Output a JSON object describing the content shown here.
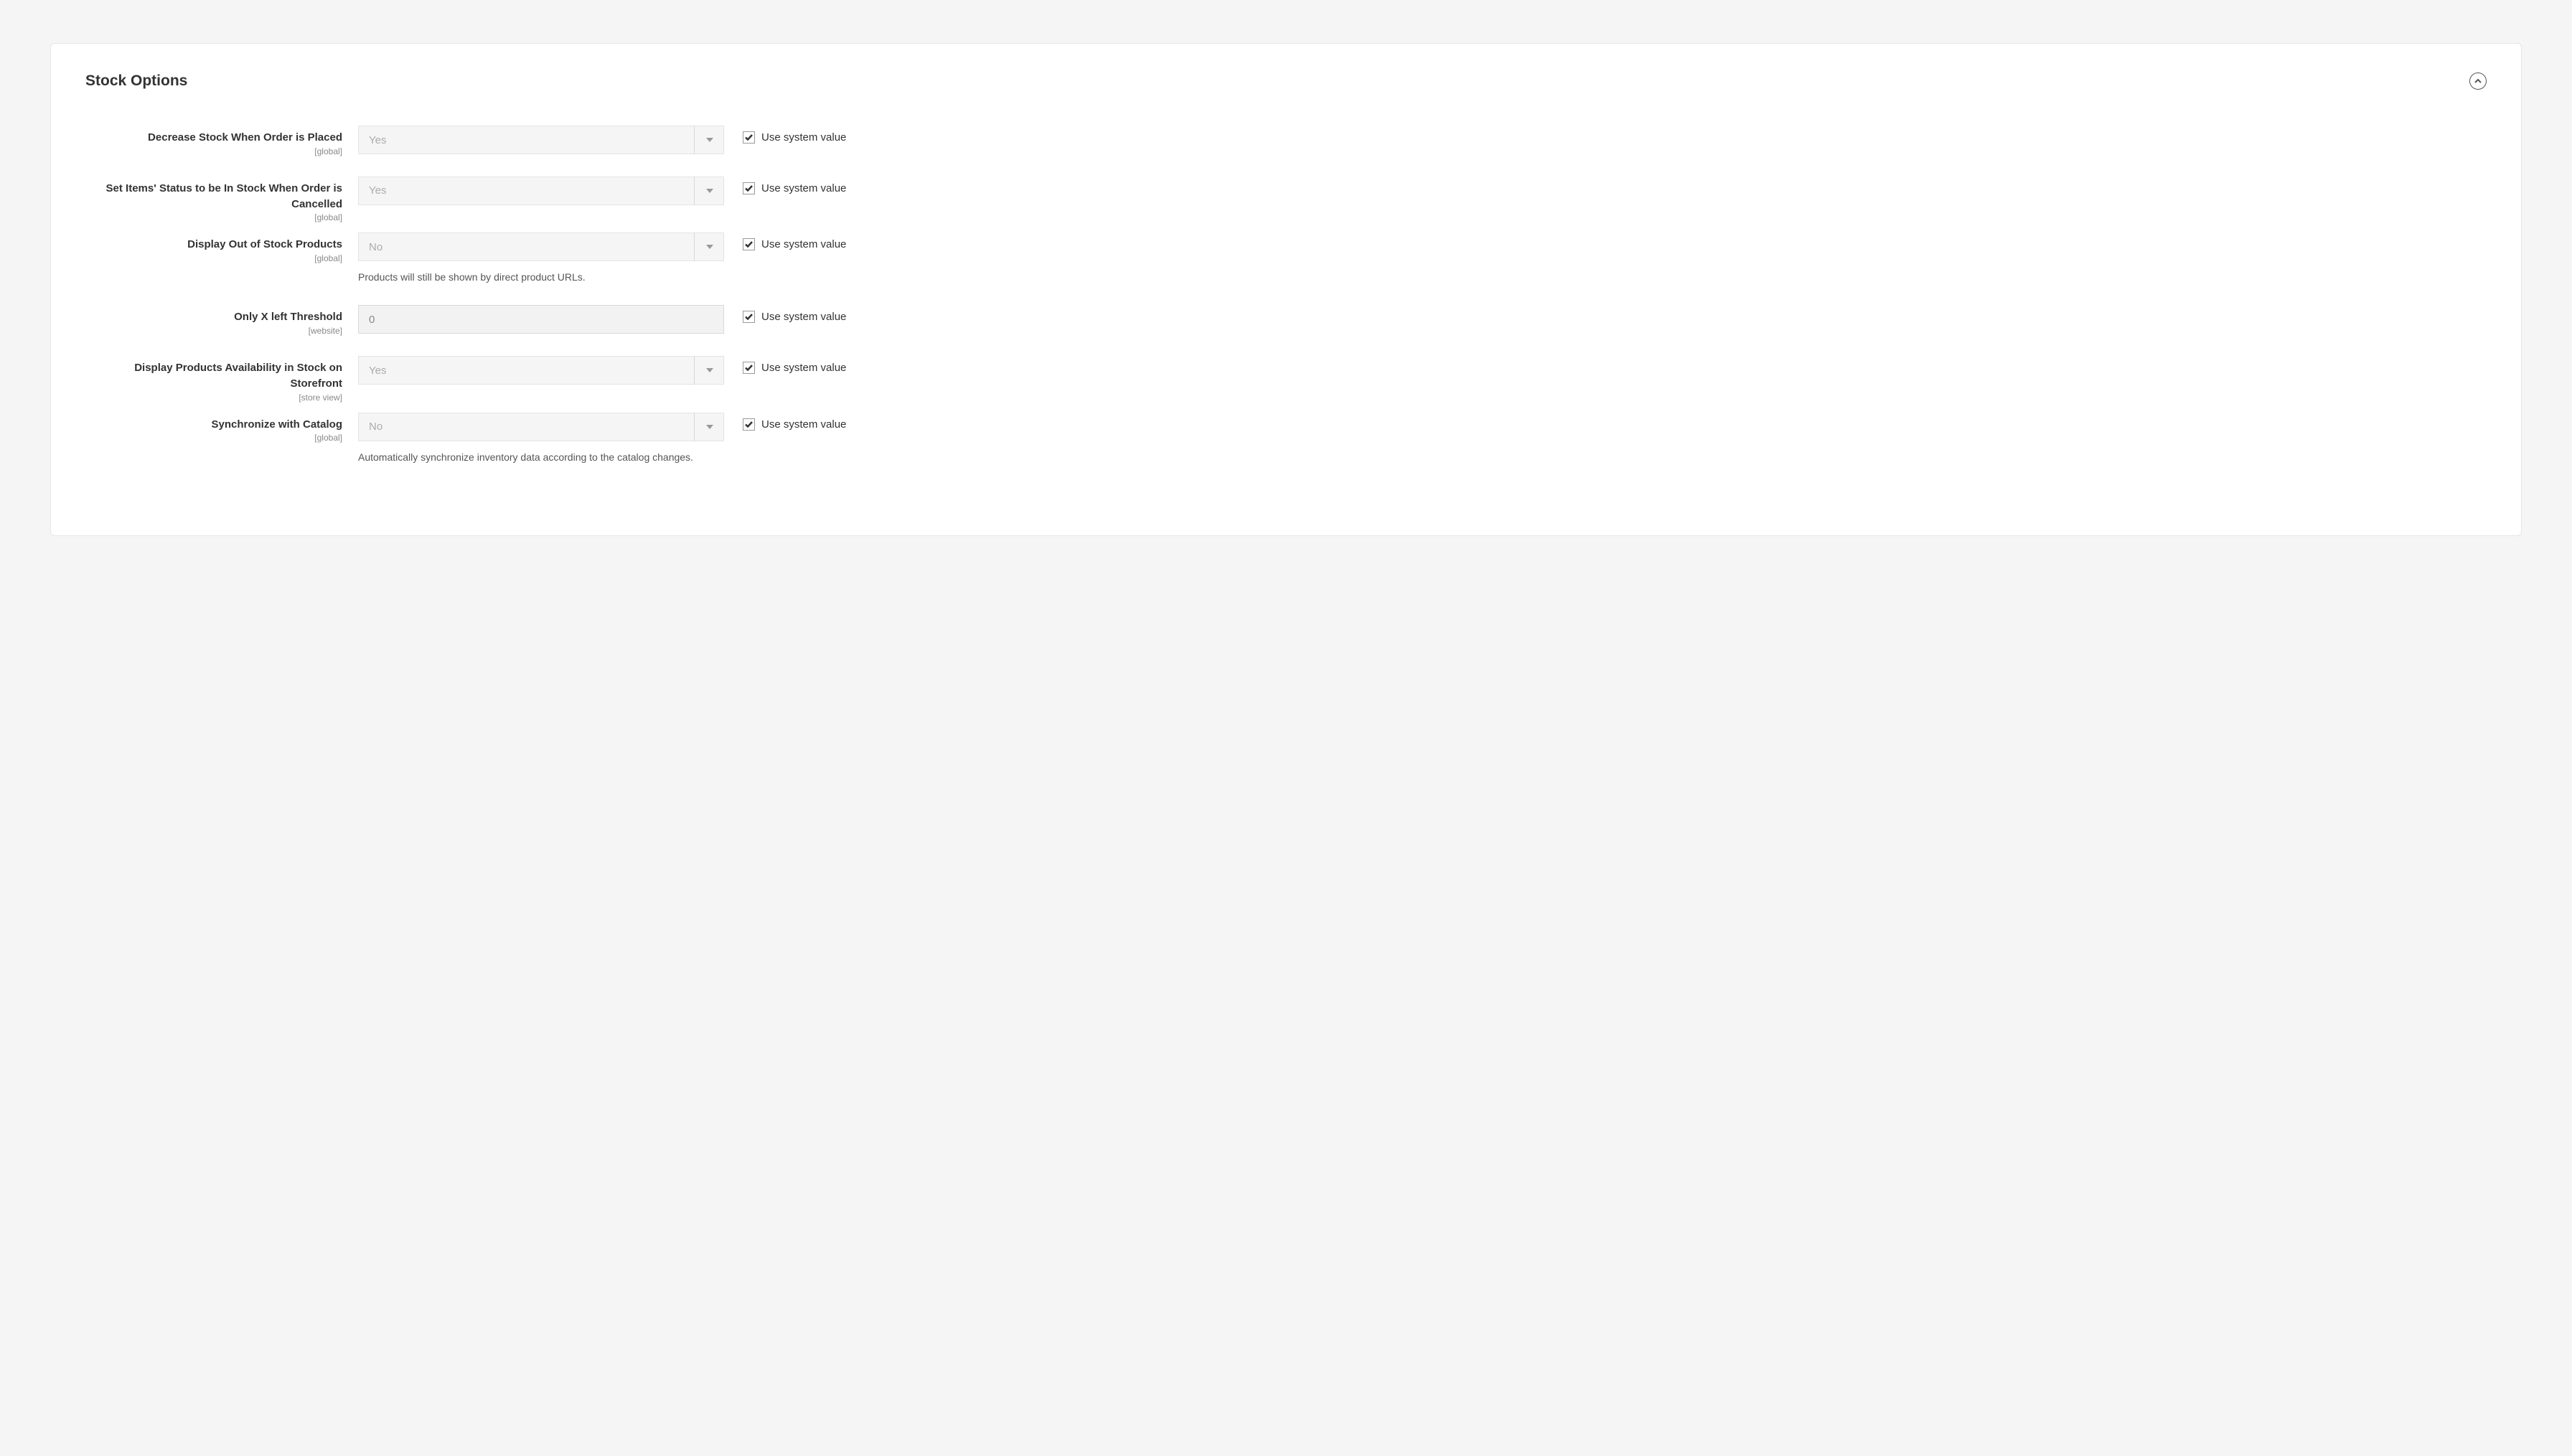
{
  "panel": {
    "title": "Stock Options"
  },
  "common": {
    "use_system_label": "Use system value"
  },
  "fields": {
    "decrease_stock": {
      "label": "Decrease Stock When Order is Placed",
      "scope": "[global]",
      "value": "Yes"
    },
    "set_in_stock_on_cancel": {
      "label": "Set Items' Status to be In Stock When Order is Cancelled",
      "scope": "[global]",
      "value": "Yes"
    },
    "display_out_of_stock": {
      "label": "Display Out of Stock Products",
      "scope": "[global]",
      "value": "No",
      "help": "Products will still be shown by direct product URLs."
    },
    "threshold": {
      "label": "Only X left Threshold",
      "scope": "[website]",
      "value": "0"
    },
    "display_availability": {
      "label": "Display Products Availability in Stock on Storefront",
      "scope": "[store view]",
      "value": "Yes"
    },
    "sync_catalog": {
      "label": "Synchronize with Catalog",
      "scope": "[global]",
      "value": "No",
      "help": "Automatically synchronize inventory data according to the catalog changes."
    }
  }
}
